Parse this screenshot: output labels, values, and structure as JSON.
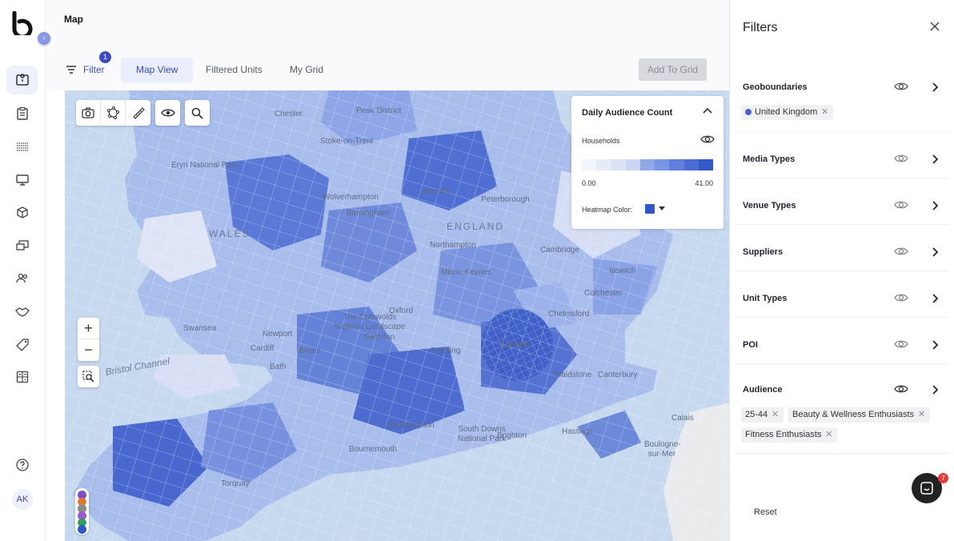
{
  "header": {
    "page_title": "Map",
    "filter_label": "Filter",
    "filter_badge": "1",
    "tabs": [
      {
        "label": "Map View",
        "active": true
      },
      {
        "label": "Filtered Units",
        "active": false
      },
      {
        "label": "My Grid",
        "active": false
      }
    ],
    "add_to_grid": "Add To Grid"
  },
  "sidebar": {
    "items": [
      {
        "icon": "map-icon",
        "active": true
      },
      {
        "icon": "clipboard-icon",
        "active": false
      },
      {
        "icon": "grid-list-icon",
        "active": false
      },
      {
        "icon": "monitor-icon",
        "active": false
      },
      {
        "icon": "cube-icon",
        "active": false
      },
      {
        "icon": "screens-icon",
        "active": false
      },
      {
        "icon": "users-icon",
        "active": false
      },
      {
        "icon": "handshake-icon",
        "active": false
      },
      {
        "icon": "tag-icon",
        "active": false
      },
      {
        "icon": "calculator-icon",
        "active": false
      }
    ],
    "help_icon": "help-icon",
    "avatar_initials": "AK"
  },
  "map": {
    "labels": {
      "chester": "Chester",
      "stoke": "Stoke-on-Trent",
      "peak": "Peak District",
      "leicester": "Leicester",
      "peterborough": "Peterborough",
      "wolverhampton": "Wolverhampton",
      "birmingham": "Birmingham",
      "england": "ENGLAND",
      "northampton": "Northampton",
      "cambridge": "Cambridge",
      "wales": "WALES",
      "milton": "Milton Keynes",
      "ipswich": "Ipswich",
      "colchester": "Colchester",
      "chelmsford": "Chelmsford",
      "oxford": "Oxford",
      "cotswolds": "The Cotswolds National Landscape",
      "swansea": "Swansea",
      "newport": "Newport",
      "cardiff": "Cardiff",
      "swindon": "Swindon",
      "reading": "Reading",
      "london": "London",
      "bristol": "Bristol",
      "bath": "Bath",
      "maidstone": "Maidstone",
      "canterbury": "Canterbury",
      "bristol_channel": "Bristol Channel",
      "southampton": "Southampton",
      "south_downs": "South Downs National Park",
      "brighton": "Brighton",
      "hastings": "Hastings",
      "bournemouth": "Bournemouth",
      "torquay": "Torquay",
      "calais": "Calais",
      "boulogne": "Boulogne-sur-Mer",
      "eryri": "Eryri National Park"
    },
    "tools": [
      "camera-icon",
      "polygon-icon",
      "ruler-icon",
      "eye-icon",
      "search-icon"
    ],
    "swatch_colors": [
      "#7b4fc4",
      "#e8772e",
      "#8a8a8a",
      "#9b59d0",
      "#2f9e5c",
      "#2f57c9"
    ]
  },
  "legend": {
    "title": "Daily Audience Count",
    "metric": "Households",
    "min": "0.00",
    "max": "41.00",
    "heatmap_label": "Heatmap Color:",
    "heatmap_color": "#2f57c9",
    "ramp_colors": [
      "#f3f5fc",
      "#e8ecf9",
      "#dbe2f6",
      "#ccd6f3",
      "#8fa8e8",
      "#7896e3",
      "#5f80dc",
      "#4a6cd4",
      "#3558c8"
    ]
  },
  "filters": {
    "title": "Filters",
    "sections": [
      {
        "label": "Geoboundaries"
      },
      {
        "label": "Media Types"
      },
      {
        "label": "Venue Types"
      },
      {
        "label": "Suppliers"
      },
      {
        "label": "Unit Types"
      },
      {
        "label": "POI"
      },
      {
        "label": "Audience"
      }
    ],
    "geo_chip": "United Kingdom",
    "audience_chips": [
      "25-44",
      "Beauty & Wellness Enthusiasts",
      "Fitness Enthusiasts"
    ],
    "reset_label": "Reset",
    "chat_badge": "7"
  }
}
